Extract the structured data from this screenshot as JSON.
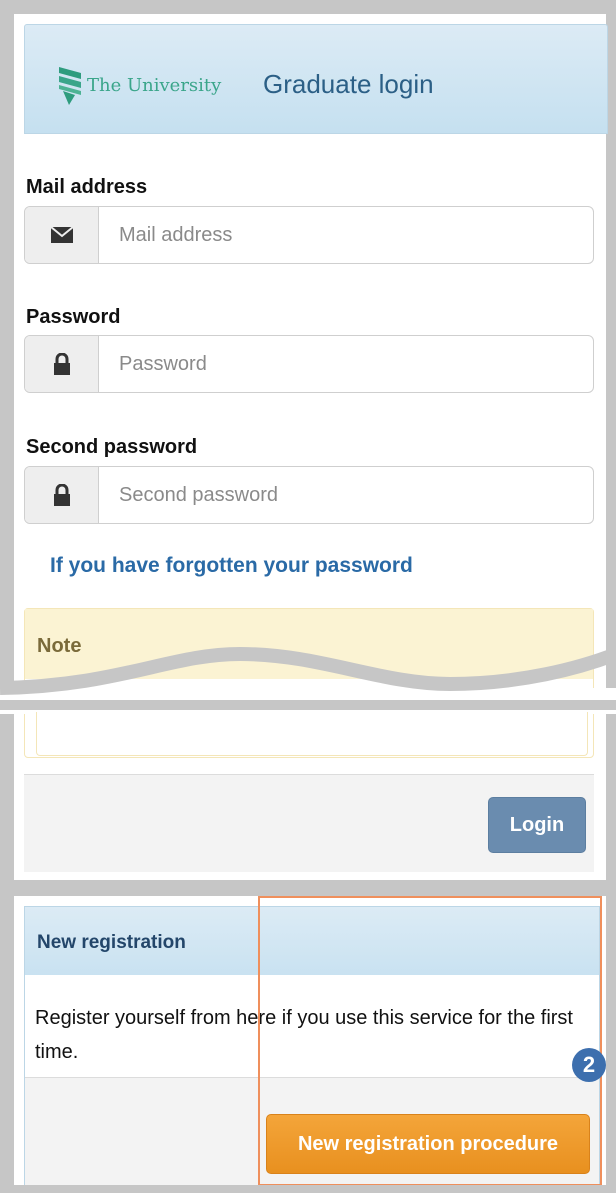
{
  "header": {
    "logo_text": "The University",
    "title": "Graduate login"
  },
  "form": {
    "mail": {
      "label": "Mail address",
      "placeholder": "Mail address",
      "icon": "envelope-icon"
    },
    "password": {
      "label": "Password",
      "placeholder": "Password",
      "icon": "lock-icon"
    },
    "second_password": {
      "label": "Second password",
      "placeholder": "Second password",
      "icon": "lock-icon"
    },
    "forgot_link": "If you have forgotten your password",
    "login_label": "Login"
  },
  "note": {
    "title": "Note"
  },
  "registration": {
    "title": "New registration",
    "description": "Register yourself from here if you use this service for the first time.",
    "button_label": "New registration procedure",
    "step_number": "2"
  },
  "colors": {
    "header_text": "#2b5f86",
    "link": "#2a6aa6",
    "login_button": "#6a8caf",
    "register_button": "#f0a030",
    "highlight": "#ef8f5c",
    "badge": "#3d6fae"
  }
}
